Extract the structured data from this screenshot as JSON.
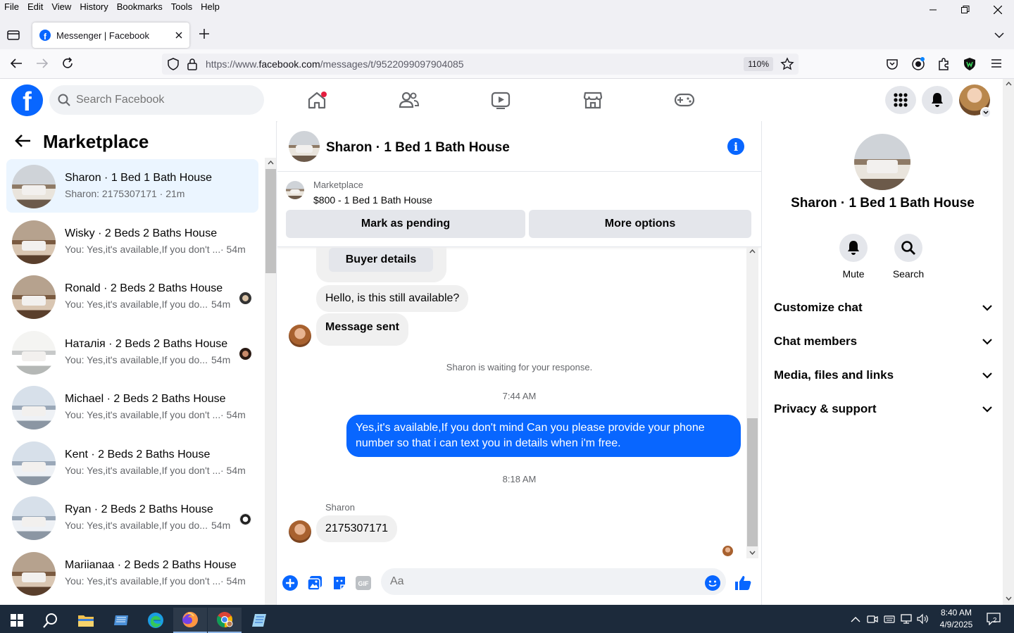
{
  "browser": {
    "menu": [
      "File",
      "Edit",
      "View",
      "History",
      "Bookmarks",
      "Tools",
      "Help"
    ],
    "tab_title": "Messenger | Facebook",
    "url_prefix": "https://www.",
    "url_domain": "facebook.com",
    "url_path": "/messages/t/9522099097904085",
    "zoom": "110%"
  },
  "fb": {
    "search_placeholder": "Search Facebook"
  },
  "left": {
    "title": "Marketplace",
    "chats": [
      {
        "name": "Sharon · 1 Bed 1 Bath House",
        "preview": "Sharon: 2175307171 · 21m",
        "time": ""
      },
      {
        "name": "Wisky · 2 Beds 2 Baths House",
        "preview": "You: Yes,it's available,If you don't ...",
        "time": "· 54m"
      },
      {
        "name": "Ronald · 2 Beds 2 Baths House",
        "preview": "You: Yes,it's available,If you do...",
        "time": "54m"
      },
      {
        "name": "Наталія · 2 Beds 2 Baths House",
        "preview": "You: Yes,it's available,If you do...",
        "time": "54m"
      },
      {
        "name": "Michael · 2 Beds 2 Baths House",
        "preview": "You: Yes,it's available,If you don't ...",
        "time": "· 54m"
      },
      {
        "name": "Kent · 2 Beds 2 Baths House",
        "preview": "You: Yes,it's available,If you don't ...",
        "time": "· 54m"
      },
      {
        "name": "Ryan · 2 Beds 2 Baths House",
        "preview": "You: Yes,it's available,If you do...",
        "time": "54m"
      },
      {
        "name": "Mariianaa · 2 Beds 2 Baths House",
        "preview": "You: Yes,it's available,If you don't ...",
        "time": "· 54m"
      }
    ]
  },
  "conversation": {
    "title": "Sharon · 1 Bed 1 Bath House",
    "marketplace_label": "Marketplace",
    "listing": "$800 - 1 Bed 1 Bath House",
    "mark_pending": "Mark as pending",
    "more_options": "More options",
    "buyer_details": "Buyer details",
    "msg1": "Hello, is this still available?",
    "msg2": "Message sent",
    "waiting": "Sharon is waiting for your response.",
    "time1": "7:44 AM",
    "msg_out": "Yes,it's available,If you don't mind Can you please provide your phone number so that i can text you in details when i'm free.",
    "time2": "8:18 AM",
    "sender": "Sharon",
    "msg3": "2175307171",
    "composer_placeholder": "Aa"
  },
  "details": {
    "title": "Sharon · 1 Bed 1 Bath House",
    "mute": "Mute",
    "search": "Search",
    "sections": [
      "Customize chat",
      "Chat members",
      "Media, files and links",
      "Privacy & support"
    ]
  },
  "taskbar": {
    "time": "8:40 AM",
    "date": "4/9/2025",
    "notifications": "2"
  },
  "colors": {
    "fb_blue": "#0866ff",
    "active_row": "#ebf5ff",
    "taskbar": "#1c2a3b"
  }
}
